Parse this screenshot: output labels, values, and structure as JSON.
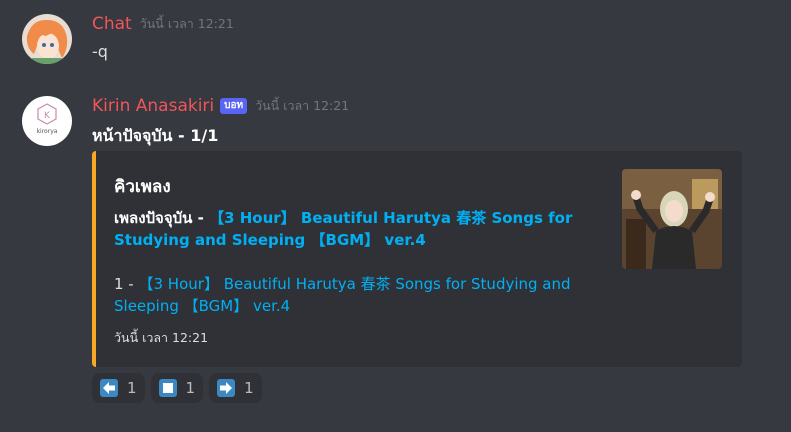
{
  "messages": [
    {
      "username": "Chat",
      "timestamp": "วันนี้ เวลา 12:21",
      "content": "-q"
    },
    {
      "username": "Kirin Anasakiri",
      "bot_tag": "บอท",
      "timestamp": "วันนี้ เวลา 12:21",
      "content": "หน้าปัจจุบัน - 1/1",
      "avatar_text": "kirorya",
      "avatar_letter": "K"
    }
  ],
  "embed": {
    "accent_color": "#f9a825",
    "title": "คิวเพลง",
    "now_playing_label": "เพลงปัจจุบัน - ",
    "now_playing_link": "【3 Hour】 Beautiful Harutya 春茶 Songs for Studying and Sleeping 【BGM】 ver.4",
    "queue_prefix": "1 - ",
    "queue_link": "【3 Hour】 Beautiful Harutya 春茶 Songs for Studying and Sleeping 【BGM】 ver.4",
    "footer": "วันนี้ เวลา 12:21"
  },
  "reactions": [
    {
      "icon": "arrow-left-icon",
      "count": "1"
    },
    {
      "icon": "stop-square-icon",
      "count": "1"
    },
    {
      "icon": "arrow-right-icon",
      "count": "1"
    }
  ],
  "colors": {
    "background": "#36393f",
    "username": "#f0555b",
    "link": "#00b0f4",
    "bot_tag": "#5865f2"
  }
}
